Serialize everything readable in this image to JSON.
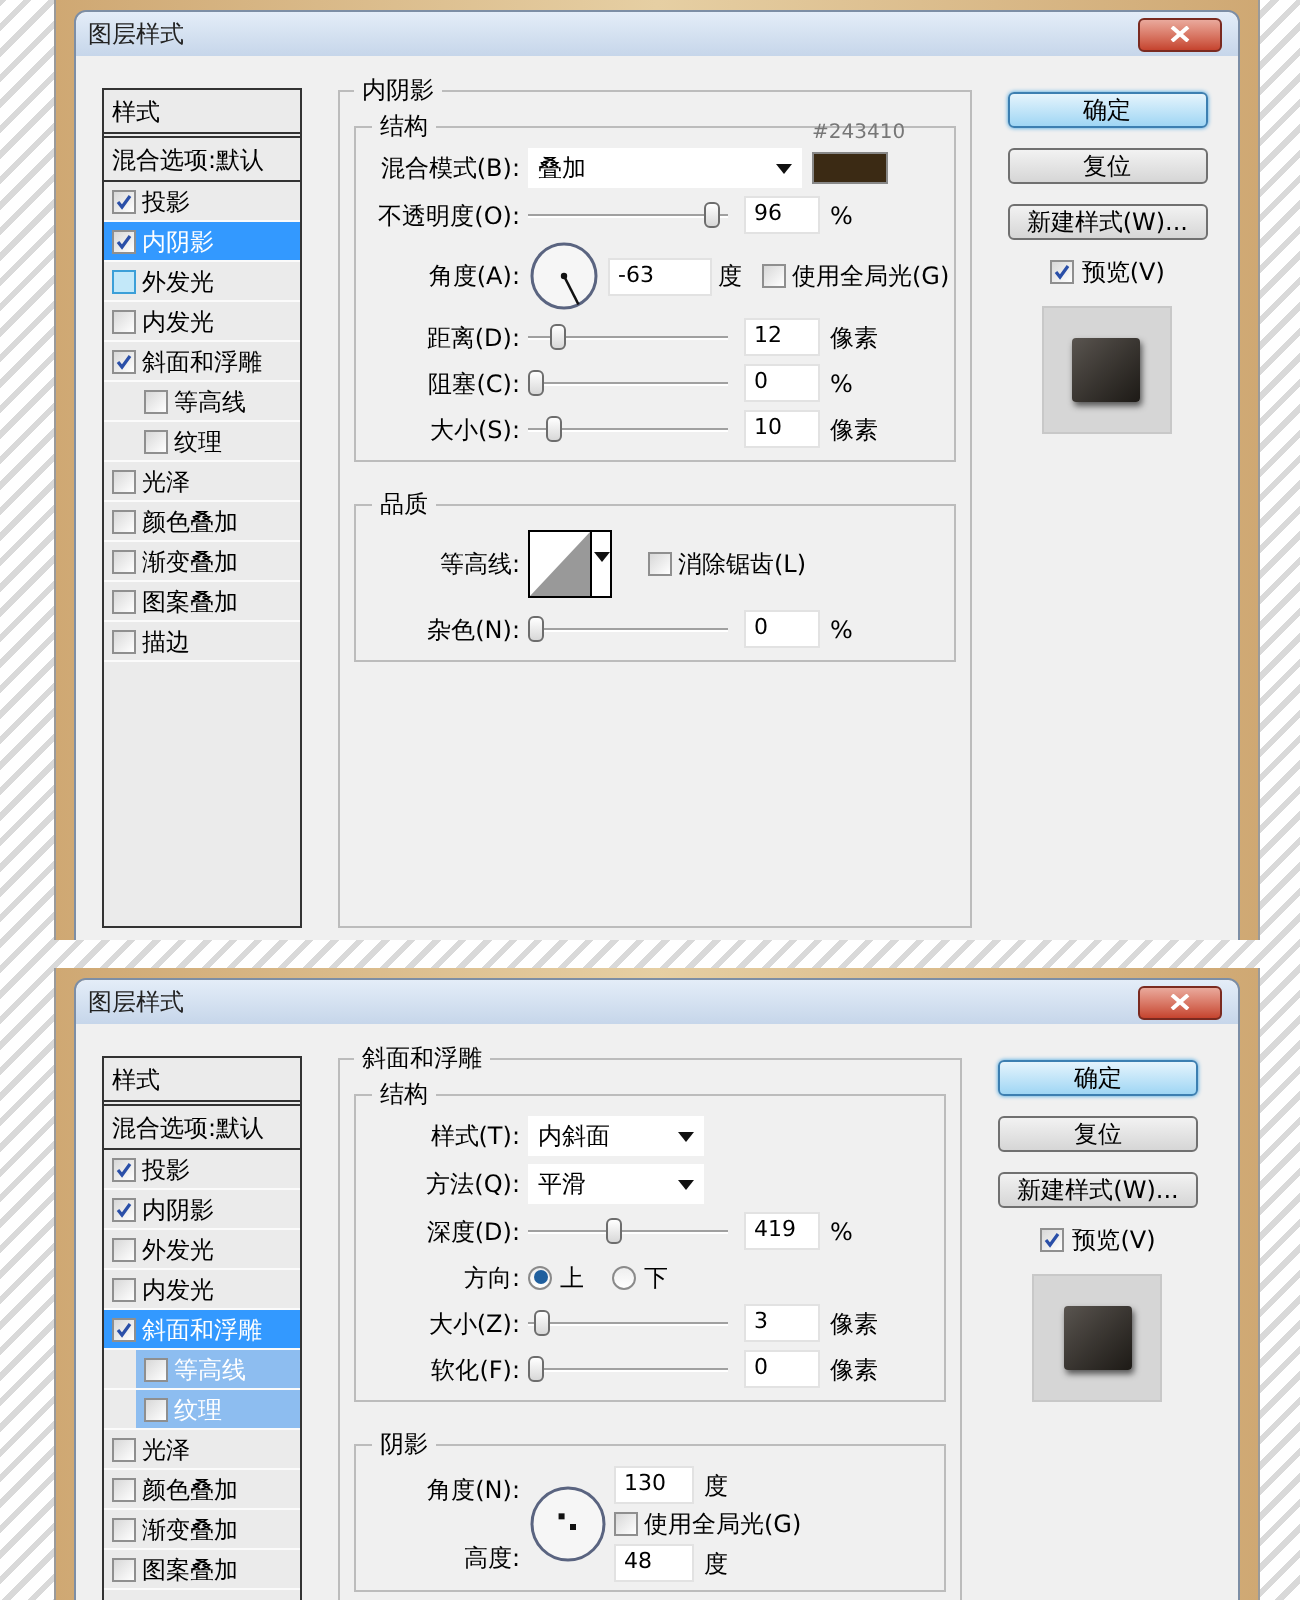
{
  "dialogs": [
    {
      "title": "图层样式",
      "style_list": {
        "header": "样式",
        "blend_options": "混合选项:默认",
        "items": [
          {
            "label": "投影",
            "checked": true,
            "selected": false
          },
          {
            "label": "内阴影",
            "checked": true,
            "selected": true
          },
          {
            "label": "外发光",
            "checked": false,
            "selected": false,
            "hover": true
          },
          {
            "label": "内发光",
            "checked": false,
            "selected": false
          },
          {
            "label": "斜面和浮雕",
            "checked": true,
            "selected": false,
            "children": [
              {
                "label": "等高线",
                "checked": false,
                "selected": false
              },
              {
                "label": "纹理",
                "checked": false,
                "selected": false
              }
            ]
          },
          {
            "label": "光泽",
            "checked": false,
            "selected": false
          },
          {
            "label": "颜色叠加",
            "checked": false,
            "selected": false
          },
          {
            "label": "渐变叠加",
            "checked": false,
            "selected": false
          },
          {
            "label": "图案叠加",
            "checked": false,
            "selected": false
          },
          {
            "label": "描边",
            "checked": false,
            "selected": false
          }
        ]
      },
      "section": {
        "title": "内阴影",
        "groups": [
          {
            "title": "结构",
            "rows": [
              {
                "kind": "dropdown",
                "label": "混合模式(B):",
                "value": "叠加",
                "color": "#3b2a14",
                "color_note": "#243410"
              },
              {
                "kind": "slider",
                "label": "不透明度(O):",
                "level": 0.96,
                "value": "96",
                "unit": "%"
              },
              {
                "kind": "angle",
                "label": "角度(A):",
                "value": "-63",
                "unit": "度",
                "global_light": {
                  "label": "使用全局光(G)",
                  "checked": false
                }
              },
              {
                "kind": "slider",
                "label": "距离(D):",
                "level": 0.12,
                "value": "12",
                "unit": "像素"
              },
              {
                "kind": "slider",
                "label": "阻塞(C):",
                "level": 0,
                "value": "0",
                "unit": "%"
              },
              {
                "kind": "slider",
                "label": "大小(S):",
                "level": 0.1,
                "value": "10",
                "unit": "像素"
              }
            ]
          },
          {
            "title": "品质",
            "rows": [
              {
                "kind": "contour",
                "label": "等高线:",
                "anti_alias": {
                  "label": "消除锯齿(L)",
                  "checked": false
                }
              },
              {
                "kind": "slider",
                "label": "杂色(N):",
                "level": 0,
                "value": "0",
                "unit": "%"
              }
            ]
          }
        ]
      },
      "buttons": [
        {
          "label": "确定",
          "default": true
        },
        {
          "label": "复位",
          "default": false
        },
        {
          "label": "新建样式(W)...",
          "default": false
        }
      ],
      "preview": {
        "label": "预览(V)",
        "checked": true
      }
    },
    {
      "title": "图层样式",
      "style_list": {
        "header": "样式",
        "blend_options": "混合选项:默认",
        "items": [
          {
            "label": "投影",
            "checked": true,
            "selected": false
          },
          {
            "label": "内阴影",
            "checked": true,
            "selected": false
          },
          {
            "label": "外发光",
            "checked": false,
            "selected": false
          },
          {
            "label": "内发光",
            "checked": false,
            "selected": false
          },
          {
            "label": "斜面和浮雕",
            "checked": true,
            "selected": true,
            "children": [
              {
                "label": "等高线",
                "checked": false,
                "selected": false
              },
              {
                "label": "纹理",
                "checked": false,
                "selected": false
              }
            ]
          },
          {
            "label": "光泽",
            "checked": false,
            "selected": false
          },
          {
            "label": "颜色叠加",
            "checked": false,
            "selected": false
          },
          {
            "label": "渐变叠加",
            "checked": false,
            "selected": false
          },
          {
            "label": "图案叠加",
            "checked": false,
            "selected": false
          }
        ]
      },
      "section": {
        "title": "斜面和浮雕",
        "groups": [
          {
            "title": "结构",
            "rows": [
              {
                "kind": "dropdown",
                "label": "样式(T):",
                "value": "内斜面"
              },
              {
                "kind": "dropdown",
                "label": "方法(Q):",
                "value": "平滑"
              },
              {
                "kind": "slider",
                "label": "深度(D):",
                "level": 0.42,
                "value": "419",
                "unit": "%"
              },
              {
                "kind": "radio",
                "label": "方向:",
                "options": [
                  {
                    "label": "上",
                    "selected": true
                  },
                  {
                    "label": "下",
                    "selected": false
                  }
                ]
              },
              {
                "kind": "slider",
                "label": "大小(Z):",
                "level": 0.03,
                "value": "3",
                "unit": "像素"
              },
              {
                "kind": "slider",
                "label": "软化(F):",
                "level": 0,
                "value": "0",
                "unit": "像素"
              }
            ]
          },
          {
            "title": "阴影",
            "rows": [
              {
                "kind": "angle_altitude",
                "label": "角度(N):",
                "value": "130",
                "unit": "度",
                "global_light": {
                  "label": "使用全局光(G)",
                  "checked": false
                },
                "altitude_label": "高度:",
                "altitude_value": "48",
                "altitude_unit": "度"
              }
            ]
          }
        ]
      },
      "buttons": [
        {
          "label": "确定",
          "default": true
        },
        {
          "label": "复位",
          "default": false
        },
        {
          "label": "新建样式(W)...",
          "default": false
        }
      ],
      "preview": {
        "label": "预览(V)",
        "checked": true
      }
    }
  ]
}
